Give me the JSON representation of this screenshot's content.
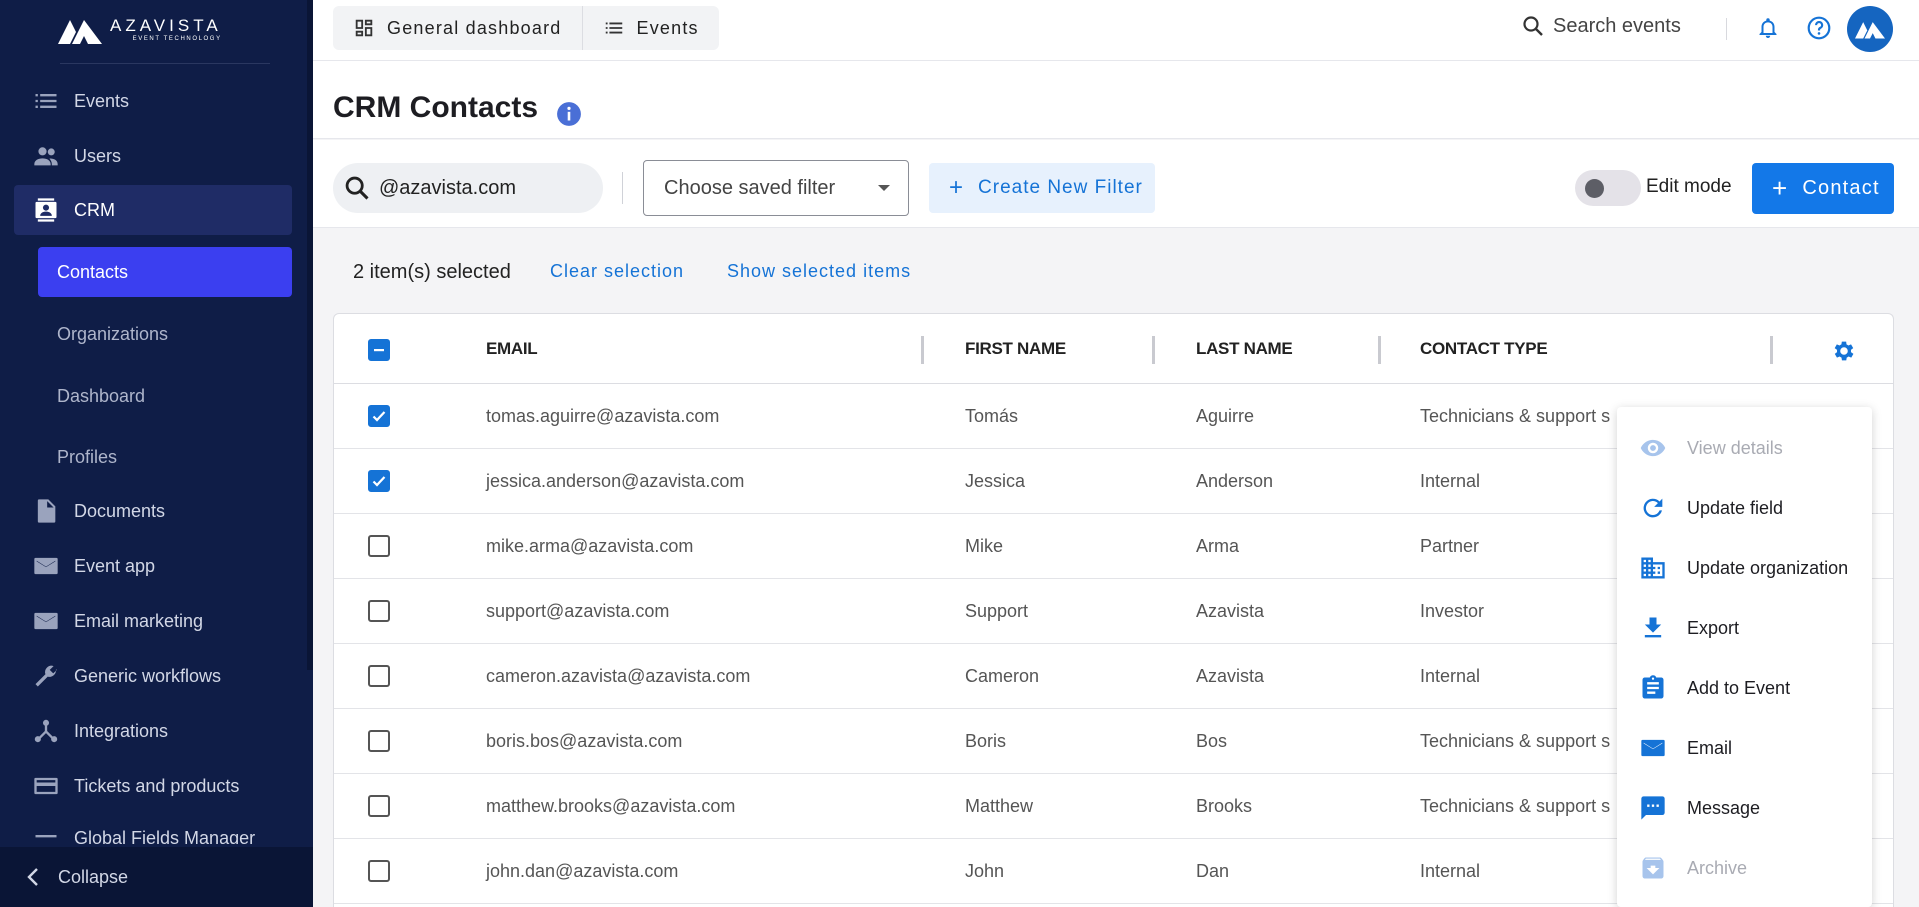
{
  "brand": {
    "name": "AZAVISTA",
    "tagline": "EVENT TECHNOLOGY"
  },
  "sidebar": {
    "items": [
      {
        "label": "Events",
        "icon": "list-icon"
      },
      {
        "label": "Users",
        "icon": "people-icon"
      },
      {
        "label": "CRM",
        "icon": "contact-card-icon"
      },
      {
        "label": "Documents",
        "icon": "document-icon"
      },
      {
        "label": "Event app",
        "icon": "mail-icon"
      },
      {
        "label": "Email marketing",
        "icon": "mail-icon"
      },
      {
        "label": "Generic workflows",
        "icon": "wrench-icon"
      },
      {
        "label": "Integrations",
        "icon": "hub-icon"
      },
      {
        "label": "Tickets and products",
        "icon": "card-icon"
      },
      {
        "label": "Global Fields Manager",
        "icon": "list-icon"
      }
    ],
    "crm_sub": [
      "Contacts",
      "Organizations",
      "Dashboard",
      "Profiles"
    ],
    "collapse_label": "Collapse"
  },
  "topbar": {
    "tabs": [
      "General dashboard",
      "Events"
    ],
    "search_label": "Search events"
  },
  "page": {
    "title": "CRM Contacts"
  },
  "filters": {
    "search_value": "@azavista.com",
    "saved_filter_placeholder": "Choose saved filter",
    "create_filter_label": "Create New Filter",
    "edit_mode_label": "Edit mode",
    "add_contact_label": "Contact"
  },
  "selection": {
    "count_text": "2 item(s) selected",
    "clear_label": "Clear selection",
    "show_label": "Show selected items"
  },
  "table": {
    "columns": [
      "EMAIL",
      "FIRST NAME",
      "LAST NAME",
      "CONTACT TYPE"
    ],
    "rows": [
      {
        "email": "tomas.aguirre@azavista.com",
        "first": "Tomás",
        "last": "Aguirre",
        "type": "Technicians & support s",
        "checked": true
      },
      {
        "email": "jessica.anderson@azavista.com",
        "first": "Jessica",
        "last": "Anderson",
        "type": "Internal",
        "checked": true
      },
      {
        "email": "mike.arma@azavista.com",
        "first": "Mike",
        "last": "Arma",
        "type": "Partner",
        "checked": false
      },
      {
        "email": "support@azavista.com",
        "first": "Support",
        "last": "Azavista",
        "type": "Investor",
        "checked": false
      },
      {
        "email": "cameron.azavista@azavista.com",
        "first": "Cameron",
        "last": "Azavista",
        "type": "Internal",
        "checked": false
      },
      {
        "email": "boris.bos@azavista.com",
        "first": "Boris",
        "last": "Bos",
        "type": "Technicians & support s",
        "checked": false
      },
      {
        "email": "matthew.brooks@azavista.com",
        "first": "Matthew",
        "last": "Brooks",
        "type": "Technicians & support s",
        "checked": false
      },
      {
        "email": "john.dan@azavista.com",
        "first": "John",
        "last": "Dan",
        "type": "Internal",
        "checked": false
      }
    ]
  },
  "context_menu": {
    "items": [
      {
        "label": "View details",
        "icon": "eye-icon",
        "disabled": true
      },
      {
        "label": "Update field",
        "icon": "refresh-icon",
        "disabled": false
      },
      {
        "label": "Update organization",
        "icon": "building-icon",
        "disabled": false
      },
      {
        "label": "Export",
        "icon": "download-icon",
        "disabled": false
      },
      {
        "label": "Add to Event",
        "icon": "clipboard-icon",
        "disabled": false
      },
      {
        "label": "Email",
        "icon": "mail-icon",
        "disabled": false
      },
      {
        "label": "Message",
        "icon": "message-icon",
        "disabled": false
      },
      {
        "label": "Archive",
        "icon": "archive-icon",
        "disabled": true
      }
    ]
  },
  "colors": {
    "sidebar_bg": "#0f1d47",
    "accent": "#1378e8",
    "selected_nav": "#3b3ff0"
  }
}
